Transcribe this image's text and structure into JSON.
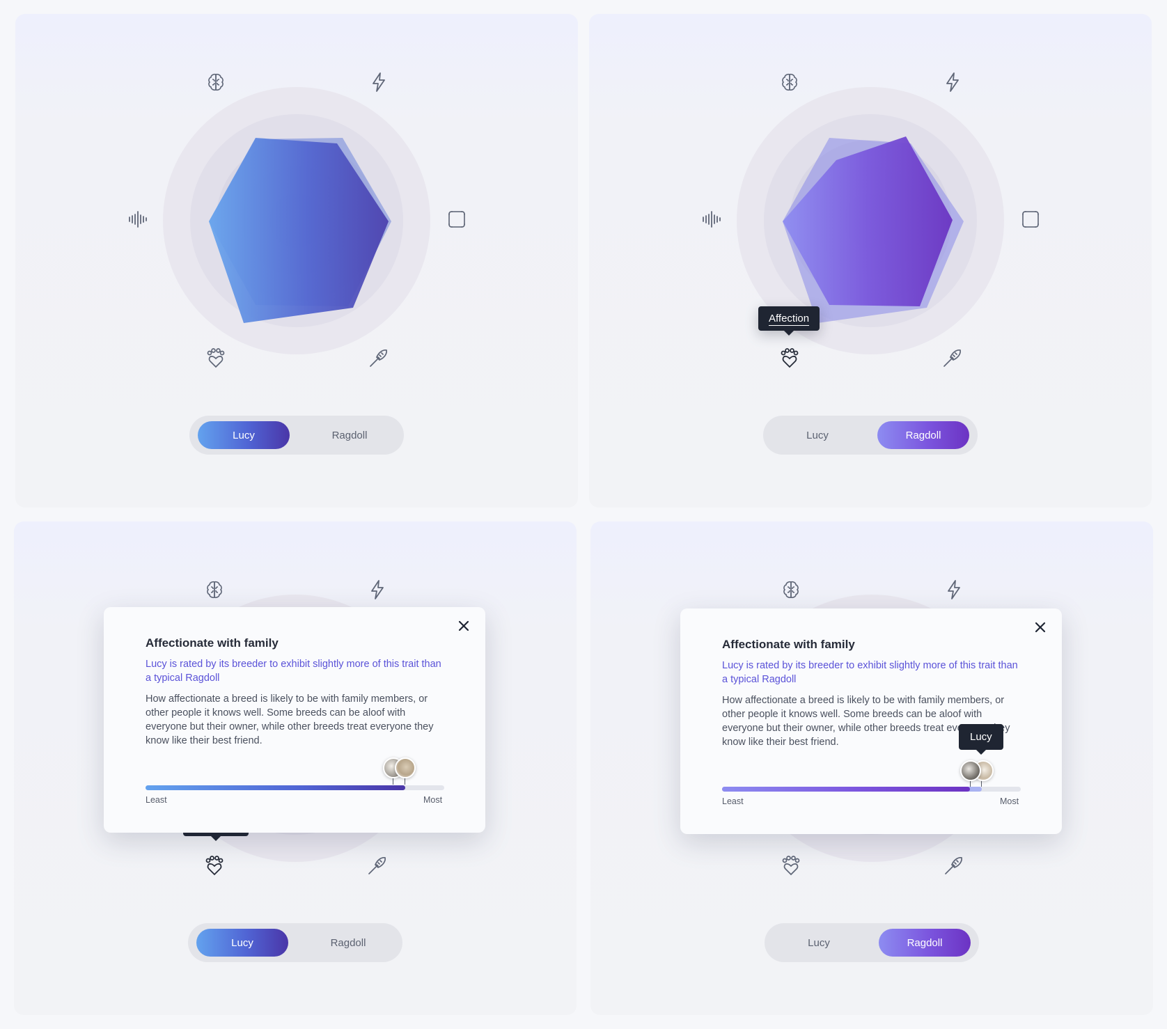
{
  "colors": {
    "lucy_gradient": [
      "#63a2ee",
      "#5064d4",
      "#4a36a8"
    ],
    "ragdoll_gradient": [
      "#8d8cf1",
      "#7b55de",
      "#6c33c3"
    ],
    "tooltip_bg": "#1f2532",
    "summary_text": "#5a52d8"
  },
  "traits": [
    {
      "icon": "brain-icon"
    },
    {
      "icon": "lightning-icon"
    },
    {
      "icon": "sound-wave-icon"
    },
    {
      "icon": "frame-corners-icon"
    },
    {
      "icon": "paw-heart-icon"
    },
    {
      "icon": "brush-icon"
    }
  ],
  "toggle": {
    "lucy": "Lucy",
    "ragdoll": "Ragdoll"
  },
  "panels": [
    {
      "selected": "Lucy"
    },
    {
      "selected": "Ragdoll",
      "tooltip": "Affection"
    },
    {
      "selected": "Lucy"
    },
    {
      "selected": "Ragdoll"
    }
  ],
  "detail": {
    "title": "Affectionate with family",
    "summary": "Lucy is rated by its breeder to exhibit slightly more of this trait than a typical Ragdoll",
    "description": "How affectionate a breed is likely to be with family members, or other people it knows well. Some breeds can be aloof with everyone but their owner, while other breeds treat everyone they know like their best friend.",
    "scale_min": "Least",
    "scale_max": "Most",
    "lucy_value": 0.87,
    "ragdoll_value": 0.83,
    "marker_tooltip": "Lucy"
  }
}
